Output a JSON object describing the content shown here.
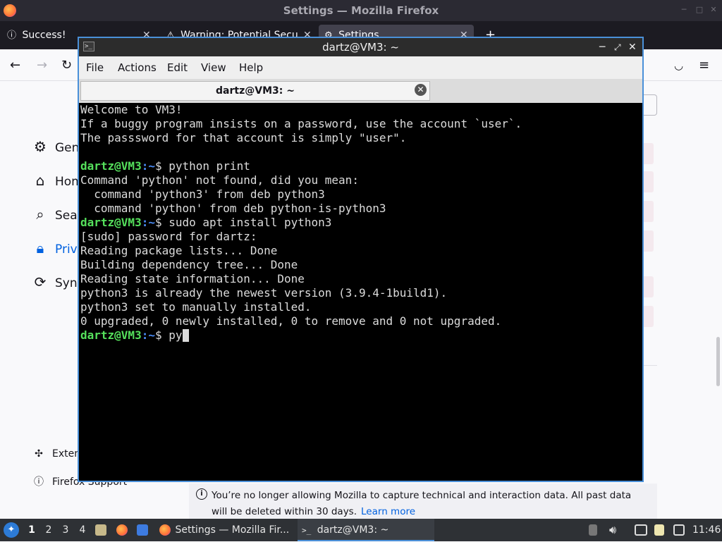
{
  "firefox": {
    "window_title": "Settings — Mozilla Firefox",
    "tabs": [
      {
        "label": "Success!"
      },
      {
        "label": "Warning: Potential Secu"
      },
      {
        "label": "Settings"
      }
    ],
    "new_tab": "+",
    "sidebar": [
      {
        "label": "Gen",
        "icon": "gear-icon"
      },
      {
        "label": "Hom",
        "icon": "home-icon"
      },
      {
        "label": "Sear",
        "icon": "search-icon"
      },
      {
        "label": "Priva",
        "icon": "lock-icon"
      },
      {
        "label": "Sync",
        "icon": "sync-icon"
      }
    ],
    "footer_links": [
      {
        "label": "Exten",
        "icon": "puzzle-icon"
      },
      {
        "label": "Firefox Support",
        "icon": "help-icon"
      }
    ],
    "infobar": {
      "text": "You’re no longer allowing Mozilla to capture technical and interaction data. All past data will be deleted within 30 days.",
      "link": "Learn more"
    }
  },
  "terminal": {
    "window_title": "dartz@VM3: ~",
    "menu": [
      "File",
      "Actions",
      "Edit",
      "View",
      "Help"
    ],
    "tab_label": "dartz@VM3: ~",
    "prompt_user": "dartz@VM3",
    "prompt_path": ":~",
    "prompt_sign": "$ ",
    "lines": [
      {
        "text": "Welcome to VM3!"
      },
      {
        "text": "If a buggy program insists on a password, use the account `user`."
      },
      {
        "text": "The passsword for that account is simply \"user\"."
      },
      {
        "text": ""
      },
      {
        "prompt": true,
        "text": "python print"
      },
      {
        "text": "Command 'python' not found, did you mean:"
      },
      {
        "text": "  command 'python3' from deb python3"
      },
      {
        "text": "  command 'python' from deb python-is-python3"
      },
      {
        "prompt": true,
        "text": "sudo apt install python3"
      },
      {
        "text": "[sudo] password for dartz:"
      },
      {
        "text": "Reading package lists... Done"
      },
      {
        "text": "Building dependency tree... Done"
      },
      {
        "text": "Reading state information... Done"
      },
      {
        "text": "python3 is already the newest version (3.9.4-1build1)."
      },
      {
        "text": "python3 set to manually installed."
      },
      {
        "text": "0 upgraded, 0 newly installed, 0 to remove and 0 not upgraded."
      },
      {
        "prompt": true,
        "text": "py",
        "cursor": true
      }
    ]
  },
  "taskbar": {
    "workspaces": [
      "1",
      "2",
      "3",
      "4"
    ],
    "tasks": [
      {
        "label": "Settings — Mozilla Fir..."
      },
      {
        "label": "dartz@VM3: ~"
      }
    ],
    "clock": "11:46"
  }
}
